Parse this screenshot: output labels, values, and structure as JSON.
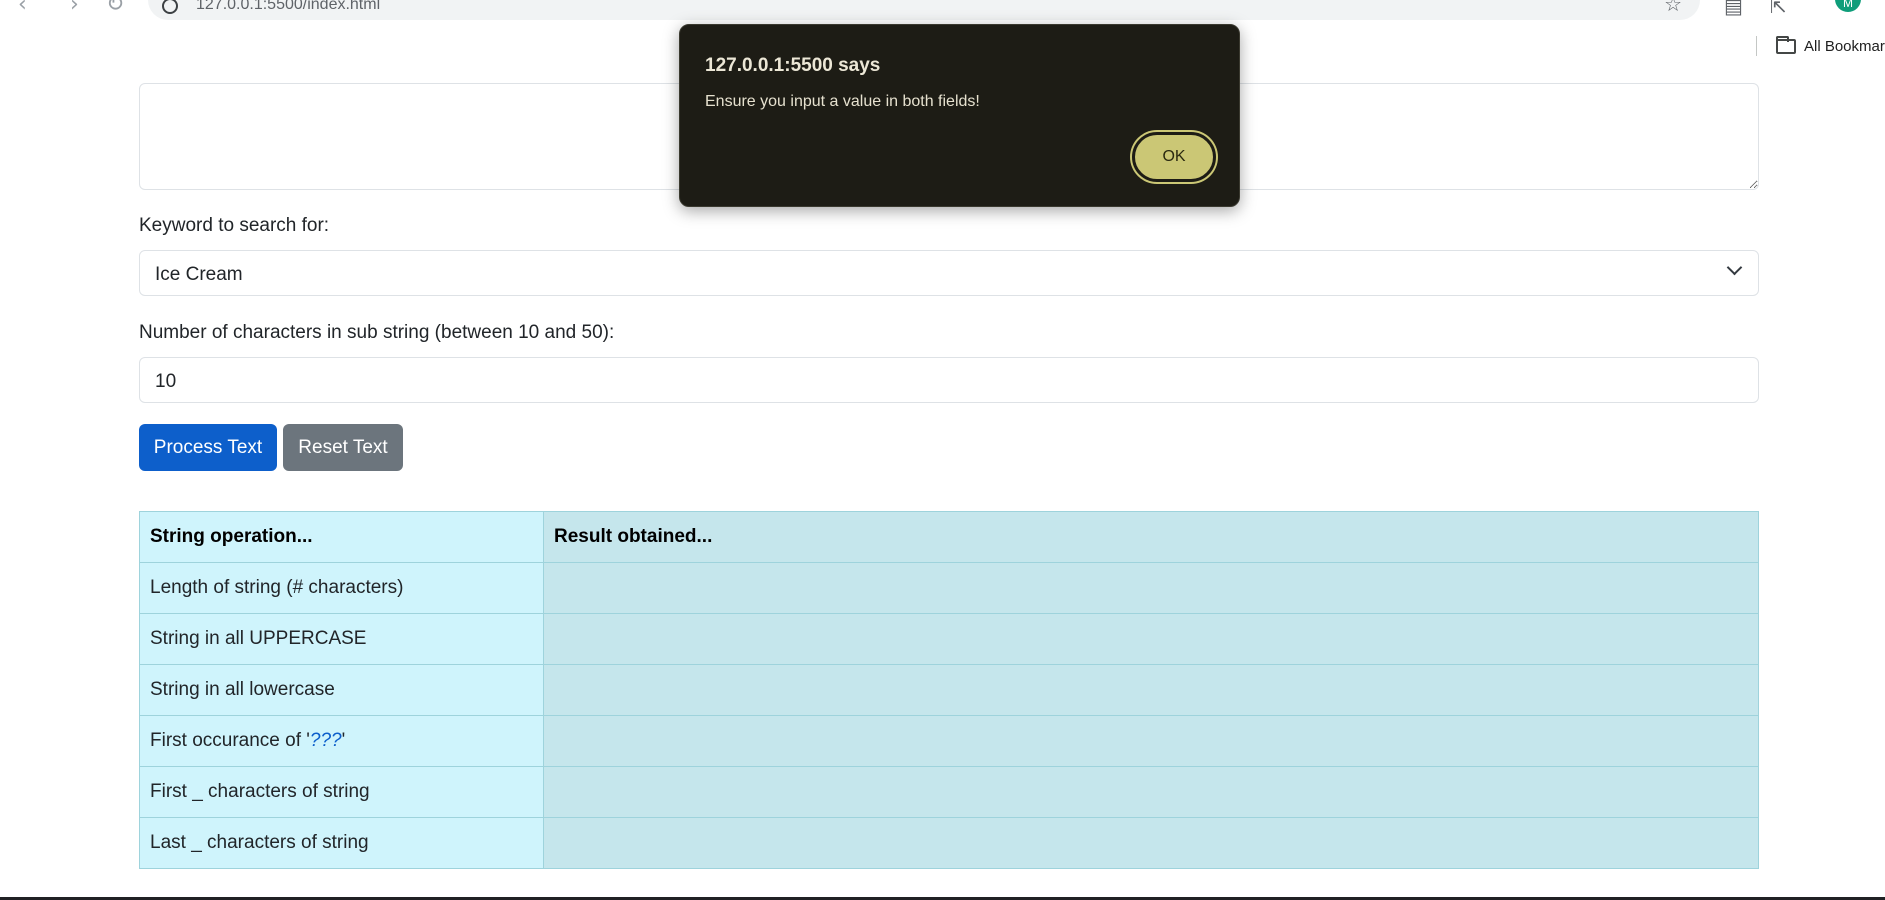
{
  "browser": {
    "url": "127.0.0.1:5500/index.html",
    "bookmarks_label": "All Bookmar",
    "avatar_initial": "M"
  },
  "form": {
    "main_text_value": "",
    "keyword_label": "Keyword to search for:",
    "keyword_selected": "Ice Cream",
    "substring_label": "Number of characters in sub string (between 10 and 50):",
    "substring_value": "10",
    "process_button": "Process Text",
    "reset_button": "Reset Text"
  },
  "table": {
    "headers": [
      "String operation...",
      "Result obtained..."
    ],
    "rows": [
      {
        "op": "Length of string (# characters)",
        "result": ""
      },
      {
        "op": "String in all UPPERCASE",
        "result": ""
      },
      {
        "op": "String in all lowercase",
        "result": ""
      },
      {
        "op_prefix": "First occurance of '",
        "op_keyword": "???",
        "op_suffix": "'",
        "result": ""
      },
      {
        "op": "First _ characters of string",
        "result": ""
      },
      {
        "op": "Last _ characters of string",
        "result": ""
      }
    ]
  },
  "dialog": {
    "title": "127.0.0.1:5500 says",
    "message": "Ensure you input a value in both fields!",
    "ok_label": "OK"
  },
  "colors": {
    "primary": "#0d5fcb",
    "secondary": "#6c757d",
    "table_info": "#cff4fc",
    "dialog_bg": "#1d1c15",
    "dialog_button": "#cbc775"
  }
}
